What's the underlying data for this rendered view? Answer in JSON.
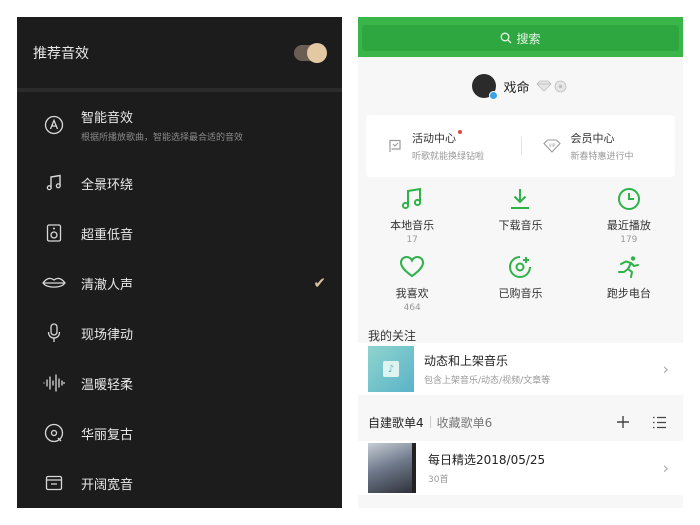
{
  "sound_effects": {
    "header_title": "推荐音效",
    "toggle_on": true,
    "items": [
      {
        "label": "智能音效",
        "desc": "根据所播放歌曲，智能选择最合适的音效",
        "icon": "letter-a-circle-icon",
        "selected": false
      },
      {
        "label": "全景环绕",
        "desc": "",
        "icon": "music-note-icon",
        "selected": false
      },
      {
        "label": "超重低音",
        "desc": "",
        "icon": "speaker-icon",
        "selected": false
      },
      {
        "label": "清澈人声",
        "desc": "",
        "icon": "lips-icon",
        "selected": true
      },
      {
        "label": "现场律动",
        "desc": "",
        "icon": "microphone-icon",
        "selected": false
      },
      {
        "label": "温暖轻柔",
        "desc": "",
        "icon": "waveform-icon",
        "selected": false
      },
      {
        "label": "华丽复古",
        "desc": "",
        "icon": "vinyl-icon",
        "selected": false
      },
      {
        "label": "开阔宽音",
        "desc": "",
        "icon": "box-icon",
        "selected": false
      }
    ],
    "check_mark": "✔"
  },
  "music_home": {
    "search_label": "搜索",
    "profile": {
      "name": "戏命"
    },
    "promo": [
      {
        "title": "活动中心",
        "sub": "听歌就能换绿钻啦",
        "icon": "flag-icon",
        "has_dot": true
      },
      {
        "title": "会员中心",
        "sub": "新春特惠进行中",
        "icon": "vip-diamond-icon",
        "has_dot": false
      }
    ],
    "grid": [
      {
        "label": "本地音乐",
        "count": "17",
        "icon": "music-note-icon"
      },
      {
        "label": "下载音乐",
        "count": "",
        "icon": "download-icon"
      },
      {
        "label": "最近播放",
        "count": "179",
        "icon": "clock-icon"
      },
      {
        "label": "我喜欢",
        "count": "464",
        "icon": "heart-icon"
      },
      {
        "label": "已购音乐",
        "count": "",
        "icon": "purchased-icon"
      },
      {
        "label": "跑步电台",
        "count": "",
        "icon": "runner-icon"
      }
    ],
    "follow_section_title": "我的关注",
    "follow_item": {
      "title": "动态和上架音乐",
      "sub": "包含上架音乐/动态/视频/文章等"
    },
    "tabs": {
      "created": "自建歌单4",
      "collected": "收藏歌单6"
    },
    "playlist": {
      "title": "每日精选2018/05/25",
      "sub": "30首"
    },
    "accent_color": "#39b54a"
  }
}
